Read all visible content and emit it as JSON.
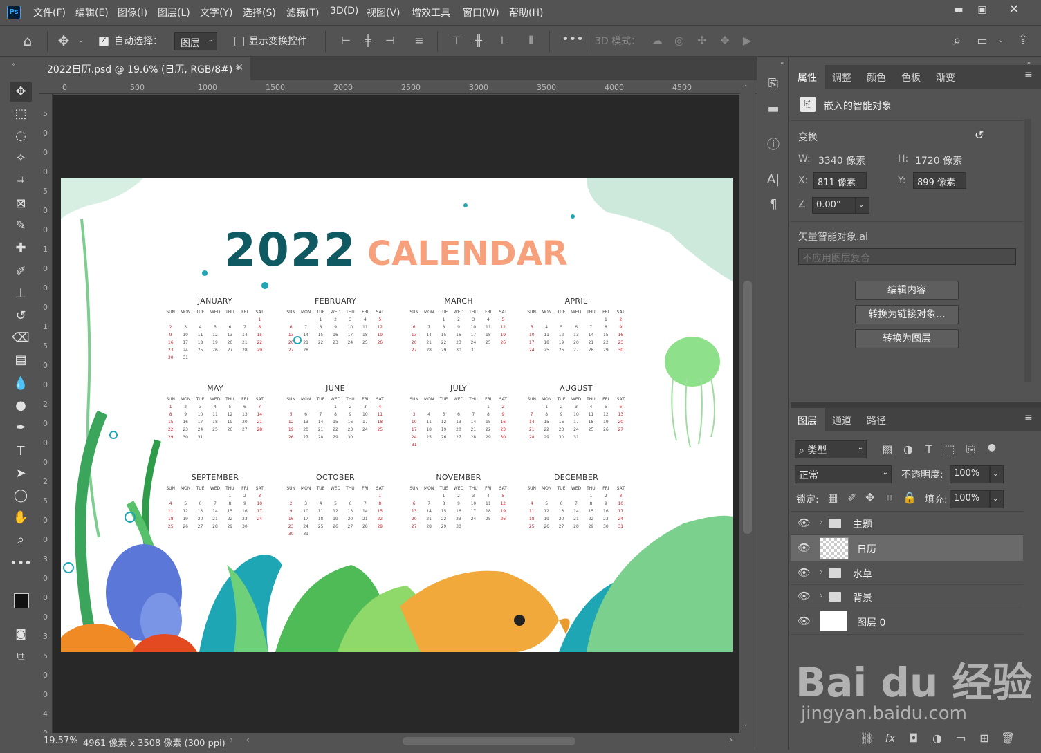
{
  "menubar": {
    "items": [
      "文件(F)",
      "编辑(E)",
      "图像(I)",
      "图层(L)",
      "文字(Y)",
      "选择(S)",
      "滤镜(T)",
      "3D(D)",
      "视图(V)",
      "增效工具",
      "窗口(W)",
      "帮助(H)"
    ]
  },
  "options": {
    "auto_select_label": "自动选择：",
    "auto_select_value": "图层",
    "show_transform_label": "显示变换控件",
    "mode_3d_label": "3D 模式："
  },
  "document": {
    "tab_title": "2022日历.psd @ 19.6% (日历, RGB/8#) *",
    "ruler_h": [
      "0",
      "500",
      "1000",
      "1500",
      "2000",
      "2500",
      "3000",
      "3500",
      "4000",
      "4500"
    ],
    "ruler_v": [
      "5",
      "0",
      "0",
      "0",
      "5",
      "0",
      "0",
      "1",
      "0",
      "0",
      "0",
      "1",
      "5",
      "0",
      "0",
      "2",
      "0",
      "0",
      "0",
      "2",
      "5",
      "0",
      "0",
      "3",
      "0",
      "0",
      "0",
      "3",
      "5",
      "0",
      "0",
      "4",
      "0"
    ],
    "zoom": "19.57%",
    "doc_info": "4961 像素 x 3508 像素 (300 ppi)"
  },
  "calendar": {
    "year": "2022",
    "title": "CALENDAR",
    "weekdays": [
      "SUN",
      "MON",
      "TUE",
      "WED",
      "THU",
      "FRI",
      "SAT"
    ],
    "months": [
      {
        "name": "JANUARY",
        "offset": 6,
        "days": 31
      },
      {
        "name": "FEBRUARY",
        "offset": 2,
        "days": 28
      },
      {
        "name": "MARCH",
        "offset": 2,
        "days": 31
      },
      {
        "name": "APRIL",
        "offset": 5,
        "days": 30
      },
      {
        "name": "MAY",
        "offset": 0,
        "days": 31
      },
      {
        "name": "JUNE",
        "offset": 3,
        "days": 30
      },
      {
        "name": "JULY",
        "offset": 5,
        "days": 31
      },
      {
        "name": "AUGUST",
        "offset": 1,
        "days": 31
      },
      {
        "name": "SEPTEMBER",
        "offset": 4,
        "days": 30
      },
      {
        "name": "OCTOBER",
        "offset": 6,
        "days": 31
      },
      {
        "name": "NOVEMBER",
        "offset": 2,
        "days": 30
      },
      {
        "name": "DECEMBER",
        "offset": 4,
        "days": 31
      }
    ]
  },
  "properties_panel": {
    "tabs": [
      "属性",
      "调整",
      "颜色",
      "色板",
      "渐变"
    ],
    "object_type": "嵌入的智能对象",
    "transform_label": "变换",
    "w_label": "W:",
    "w_value": "3340 像素",
    "h_label": "H:",
    "h_value": "1720 像素",
    "x_label": "X:",
    "x_value": "811 像素",
    "y_label": "Y:",
    "y_value": "899 像素",
    "angle_value": "0.00°",
    "source_file": "矢量智能对象.ai",
    "layer_comp": "不应用图层复合",
    "btn_edit": "编辑内容",
    "btn_convert_linked": "转换为链接对象...",
    "btn_convert_layers": "转换为图层"
  },
  "layers_panel": {
    "tabs": [
      "图层",
      "通道",
      "路径"
    ],
    "filter_kind": "类型",
    "blend_mode": "正常",
    "opacity_label": "不透明度:",
    "opacity_value": "100%",
    "lock_label": "锁定:",
    "fill_label": "填充:",
    "fill_value": "100%",
    "layers": [
      {
        "name": "主题",
        "type": "group"
      },
      {
        "name": "日历",
        "type": "smart",
        "selected": true
      },
      {
        "name": "水草",
        "type": "group"
      },
      {
        "name": "背景",
        "type": "group"
      },
      {
        "name": "图层 0",
        "type": "pixel"
      }
    ]
  },
  "watermark": {
    "brand": "Bai du 经验",
    "url": "jingyan.baidu.com"
  },
  "colors": {
    "year_color": "#0f5a62",
    "calendar_title_color": "#f6a07c",
    "weekend_color": "#d0202a"
  }
}
